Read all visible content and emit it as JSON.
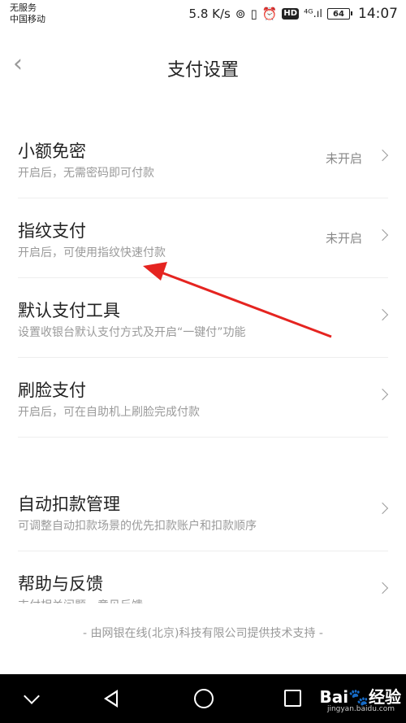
{
  "status_bar": {
    "carrier_line1": "无服务",
    "carrier_line2": "中国移动",
    "speed": "5.8 K/s",
    "hd": "HD",
    "signal": "⁴ᴳ.ıl",
    "battery": "64",
    "time": "14:07"
  },
  "header": {
    "back_symbol": "‹",
    "title": "支付设置"
  },
  "settings": [
    {
      "title": "小额免密",
      "subtitle": "开启后，无需密码即可付款",
      "status": "未开启"
    },
    {
      "title": "指纹支付",
      "subtitle": "开启后，可使用指纹快速付款",
      "status": "未开启"
    },
    {
      "title": "默认支付工具",
      "subtitle": "设置收银台默认支付方式及开启“一键付”功能",
      "status": ""
    },
    {
      "title": "刷脸支付",
      "subtitle": "开启后，可在自助机上刷脸完成付款",
      "status": ""
    }
  ],
  "settings2": [
    {
      "title": "自动扣款管理",
      "subtitle": "可调整自动扣款场景的优先扣款账户和扣款顺序"
    },
    {
      "title": "帮助与反馈",
      "subtitle": "支付相关问题，意见反馈"
    }
  ],
  "footer": "- 由网银在线(北京)科技有限公司提供技术支持 -",
  "watermark": {
    "brand": "Bai🐾经验",
    "url": "jingyan.baidu.com"
  },
  "colors": {
    "annotation_arrow": "#e52420",
    "nav_bar": "#000000"
  }
}
